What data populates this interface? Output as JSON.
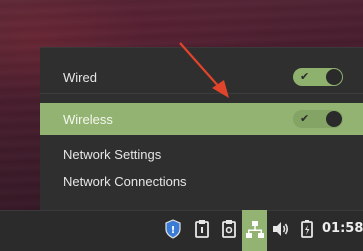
{
  "menu": {
    "wired_label": "Wired",
    "wireless_label": "Wireless",
    "settings_label": "Network Settings",
    "connections_label": "Network Connections",
    "wired_enabled": true,
    "wireless_enabled": true
  },
  "taskbar": {
    "clock": "01:58",
    "icons": [
      "shield-icon",
      "clipboard-icon",
      "display-manager-icon",
      "network-icon",
      "volume-icon",
      "battery-icon"
    ]
  },
  "colors": {
    "accent": "#92b372",
    "menu_bg": "#2f2f2f",
    "taskbar_bg": "#2b2b2b",
    "arrow": "#e0442a"
  }
}
